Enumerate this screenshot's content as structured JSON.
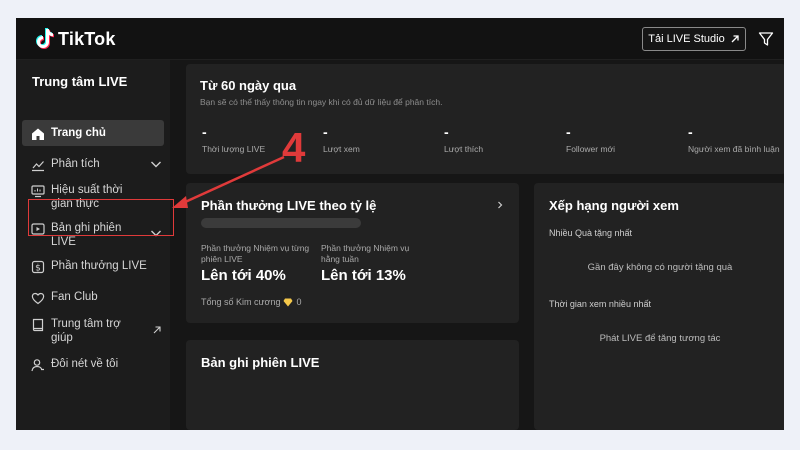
{
  "app": {
    "logo_text": "TikTok"
  },
  "header": {
    "studio_button": "Tải LIVE Studio"
  },
  "sidebar": {
    "title": "Trung tâm LIVE",
    "items": [
      {
        "label": "Trang chủ"
      },
      {
        "label": "Phân tích"
      },
      {
        "label": "Hiệu suất thời gian thực"
      },
      {
        "label": "Bản ghi phiên LIVE"
      },
      {
        "label": "Phần thưởng LIVE"
      },
      {
        "label": "Fan Club"
      },
      {
        "label": "Trung tâm trợ giúp"
      },
      {
        "label": "Đôi nét về tôi"
      }
    ]
  },
  "overview": {
    "title": "Từ 60 ngày qua",
    "subtitle": "Bạn sẽ có thể thấy thông tin ngay khi có đủ dữ liệu để phân tích.",
    "stats": [
      {
        "value": "-",
        "label": "Thời lượng LIVE"
      },
      {
        "value": "-",
        "label": "Lượt xem"
      },
      {
        "value": "-",
        "label": "Lượt thích"
      },
      {
        "value": "-",
        "label": "Follower mới"
      },
      {
        "value": "-",
        "label": "Người xem đã bình luận"
      }
    ]
  },
  "rewards": {
    "title": "Phần thưởng LIVE theo tỷ lệ",
    "left_label": "Phần thưởng Nhiệm vụ từng phiên LIVE",
    "left_value": "Lên tới 40%",
    "right_label": "Phần thưởng Nhiệm vụ hằng tuần",
    "right_value": "Lên tới 13%",
    "diamonds_label": "Tổng số Kim cương",
    "diamonds_value": "0"
  },
  "ranking": {
    "title": "Xếp hạng người xem",
    "top_gifts_label": "Nhiều Quà tặng nhất",
    "top_gifts_empty": "Gần đây không có người tặng quà",
    "top_watch_label": "Thời gian xem nhiều nhất",
    "top_watch_empty": "Phát LIVE để tăng tương tác"
  },
  "records": {
    "title": "Bản ghi phiên LIVE"
  },
  "annotation": {
    "number": "4",
    "color": "#e03a3a"
  },
  "colors": {
    "background": "#161616",
    "panel": "#222222",
    "accent": "#e03a3a"
  },
  "icons": [
    "tiktok-logo-icon",
    "external-link-icon",
    "filter-icon",
    "home-icon",
    "chart-icon",
    "monitor-icon",
    "video-record-icon",
    "reward-icon",
    "heart-icon",
    "book-icon",
    "user-icon",
    "chevron-down-icon",
    "chevron-right-icon",
    "diamond-icon"
  ]
}
